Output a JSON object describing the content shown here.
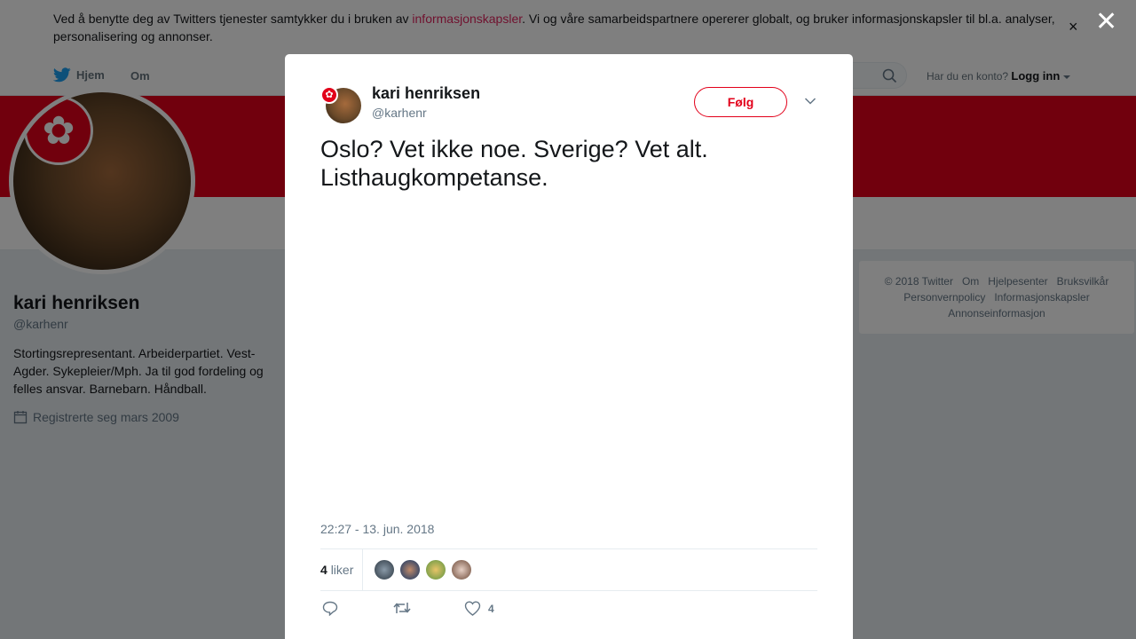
{
  "cookie_banner": {
    "text_before": "Ved å benytte deg av Twitters tjenester samtykker du i bruken av ",
    "link": "informasjonskapsler",
    "text_after": ". Vi og våre samarbeidspartnere opererer globalt, og bruker informasjonskapsler til bl.a. analyser, personalisering og annonser.",
    "close_glyph": "×"
  },
  "nav": {
    "home": "Hjem",
    "about": "Om",
    "account_question": "Har du en konto?",
    "login": "Logg inn"
  },
  "profile": {
    "name": "kari henriksen",
    "handle": "@karhenr",
    "bio": "Stortingsrepresentant. Arbeiderpartiet. Vest-Agder. Sykepleier/Mph. Ja til god fordeling og felles ansvar. Barnebarn. Håndball.",
    "joined": "Registrerte seg mars 2009"
  },
  "footer": {
    "links": [
      "© 2018 Twitter",
      "Om",
      "Hjelpesenter",
      "Bruksvilkår",
      "Personvernpolicy",
      "Informasjonskapsler",
      "Annonseinformasjon"
    ]
  },
  "overlay": {
    "close_glyph": "✕"
  },
  "tweet": {
    "author_name": "kari henriksen",
    "author_handle": "@karhenr",
    "follow_label": "Følg",
    "text": "Oslo? Vet ikke noe. Sverige? Vet alt. Listhaugkompetanse.",
    "timestamp": "22:27 - 13. jun. 2018",
    "likes_count": "4",
    "likes_label": "liker",
    "like_action_count": "4"
  },
  "colors": {
    "brand_red": "#e2001a",
    "twitter_blue": "#1da1f2",
    "link_red": "#e0245e"
  },
  "icons": [
    "twitter-bird-icon",
    "search-icon",
    "calendar-icon",
    "chevron-down-icon",
    "reply-icon",
    "retweet-icon",
    "heart-icon",
    "close-icon"
  ]
}
